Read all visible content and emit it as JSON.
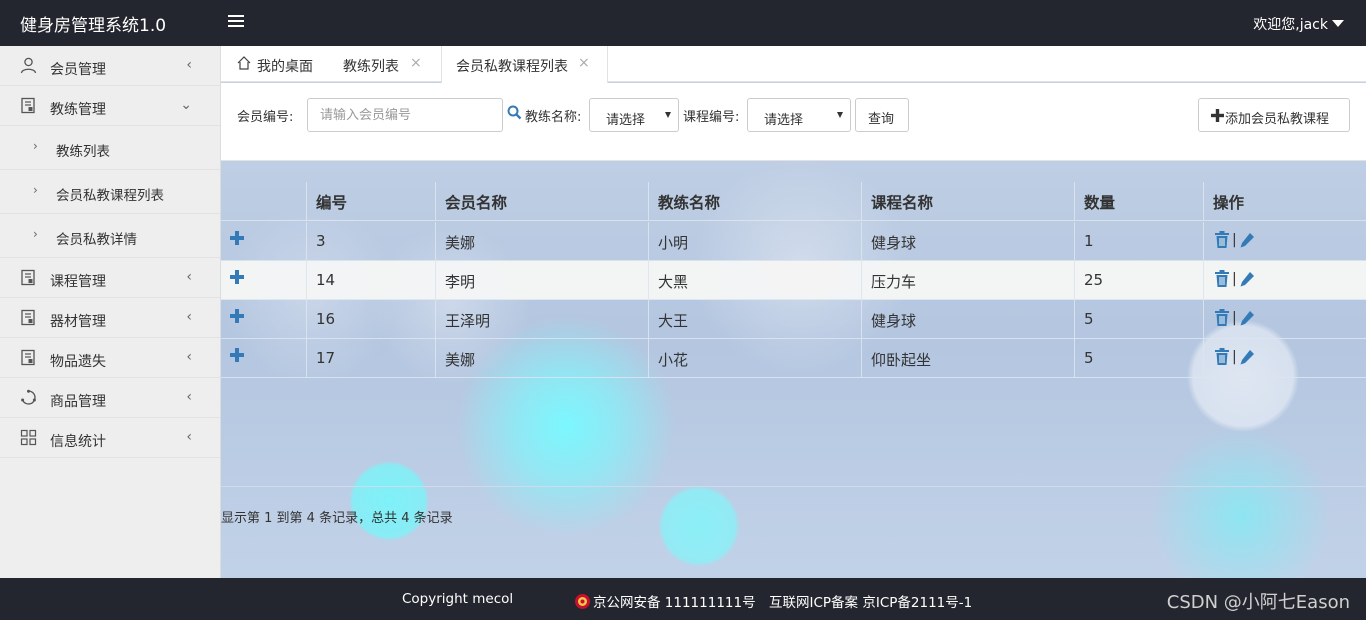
{
  "header": {
    "app_title": "健身房管理系统1.0",
    "user_text": "欢迎您,jack"
  },
  "sidebar": {
    "items": [
      {
        "label": "会员管理",
        "arrow": "‹"
      },
      {
        "label": "教练管理",
        "arrow": "⌄"
      },
      {
        "label": "课程管理",
        "arrow": "‹"
      },
      {
        "label": "器材管理",
        "arrow": "‹"
      },
      {
        "label": "物品遗失",
        "arrow": "‹"
      },
      {
        "label": "商品管理",
        "arrow": "‹"
      },
      {
        "label": "信息统计",
        "arrow": "‹"
      }
    ],
    "sub_items": [
      {
        "label": "教练列表"
      },
      {
        "label": "会员私教课程列表"
      },
      {
        "label": "会员私教详情"
      }
    ],
    "sub_arrow": "›"
  },
  "tabs": [
    {
      "label": "我的桌面"
    },
    {
      "label": "教练列表",
      "close": "×"
    },
    {
      "label": "会员私教课程列表",
      "close": "×"
    }
  ],
  "search": {
    "member_no_label": "会员编号:",
    "member_no_placeholder": "请输入会员编号",
    "coach_label": "教练名称:",
    "coach_selected": "请选择",
    "course_label": "课程编号:",
    "course_selected": "请选择",
    "query_button": "查询",
    "add_button": "添加会员私教课程"
  },
  "table": {
    "headers": [
      "编号",
      "会员名称",
      "教练名称",
      "课程名称",
      "数量",
      "操作"
    ],
    "rows": [
      [
        "3",
        "美娜",
        "小明",
        "健身球",
        "1"
      ],
      [
        "14",
        "李明",
        "大黑",
        "压力车",
        "25"
      ],
      [
        "16",
        "王泽明",
        "大王",
        "健身球",
        "5"
      ],
      [
        "17",
        "美娜",
        "小花",
        "仰卧起坐",
        "5"
      ]
    ],
    "op_separator": "|"
  },
  "pagination": {
    "info": "显示第 1 到第 4 条记录，总共 4 条记录"
  },
  "footer": {
    "copyright": "Copyright mecol",
    "police": "京公网安备 111111111号",
    "icp": "互联网ICP备案 京ICP备2111号-1",
    "watermark": "CSDN @小阿七Eason"
  },
  "colors": {
    "header_bg": "#23262e",
    "accent_blue": "#337ab7",
    "sidebar_bg": "#eeeeee"
  }
}
